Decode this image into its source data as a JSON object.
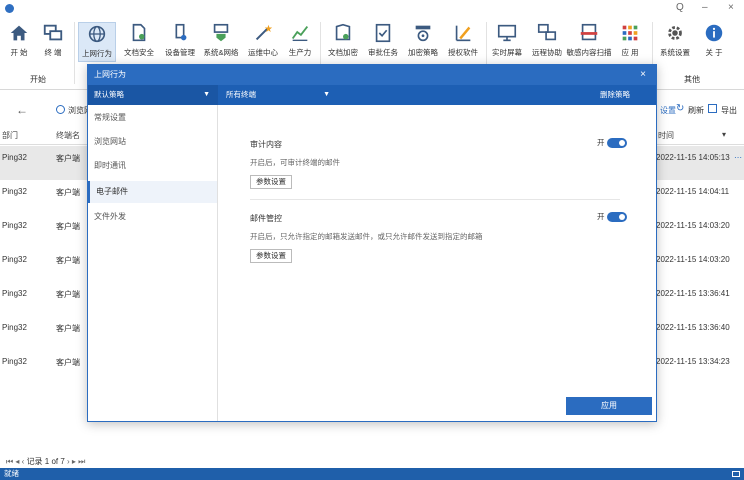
{
  "window": {
    "minimize_glyph": "–",
    "close_glyph": "×",
    "search_glyph": "Q"
  },
  "ribbon": {
    "buttons": [
      {
        "label": "开 始",
        "icon": "home-icon"
      },
      {
        "label": "终 端",
        "icon": "terminal-icon"
      },
      {
        "label": "上网行为",
        "icon": "globe-icon"
      },
      {
        "label": "文档安全",
        "icon": "document-shield-icon"
      },
      {
        "label": "设备管理",
        "icon": "device-icon"
      },
      {
        "label": "系统&网络",
        "icon": "system-network-icon"
      },
      {
        "label": "运维中心",
        "icon": "wand-icon"
      },
      {
        "label": "生产力",
        "icon": "chart-icon"
      },
      {
        "label": "文档加密",
        "icon": "encrypt-doc-icon"
      },
      {
        "label": "审批任务",
        "icon": "checklist-icon"
      },
      {
        "label": "加密策略",
        "icon": "lock-policy-icon"
      },
      {
        "label": "授权软件",
        "icon": "software-icon"
      },
      {
        "label": "实时屏幕",
        "icon": "monitor-icon"
      },
      {
        "label": "远程协助",
        "icon": "remote-icon"
      },
      {
        "label": "敏感内容扫描",
        "icon": "scan-icon"
      },
      {
        "label": "应 用",
        "icon": "apps-grid-icon"
      },
      {
        "label": "系统设置",
        "icon": "gear-icon"
      },
      {
        "label": "关 于",
        "icon": "info-icon"
      }
    ],
    "groups": {
      "start": "开始",
      "other": "其他"
    }
  },
  "subtoolbar": {
    "back_glyph": "←",
    "browse_label": "浏览网",
    "settings_label": "设置",
    "refresh_label": "刷新",
    "export_label": "导出"
  },
  "table": {
    "col_dept": "部门",
    "col_terminal": "终端名",
    "col_time": "时间",
    "rows": [
      {
        "dept": "Ping32",
        "terminal": "客户端",
        "time": "2022-11-15 14:05:13"
      },
      {
        "dept": "Ping32",
        "terminal": "客户端",
        "time": "2022-11-15 14:04:11"
      },
      {
        "dept": "Ping32",
        "terminal": "客户端",
        "time": "2022-11-15 14:03:20"
      },
      {
        "dept": "Ping32",
        "terminal": "客户端",
        "time": "2022-11-15 14:03:20"
      },
      {
        "dept": "Ping32",
        "terminal": "客户端",
        "time": "2022-11-15 13:36:41"
      },
      {
        "dept": "Ping32",
        "terminal": "客户端",
        "time": "2022-11-15 13:36:40"
      },
      {
        "dept": "Ping32",
        "terminal": "客户端",
        "time": "2022-11-15 13:34:23"
      }
    ]
  },
  "pager": {
    "text": "记录 1 of 7"
  },
  "statusbar": {
    "text": "就绪"
  },
  "modal": {
    "title": "上网行为",
    "policy": "默认策略",
    "terminal": "所有终端",
    "delete_policy": "删除策略",
    "nav": [
      "常规设置",
      "浏览网站",
      "即时通讯",
      "电子邮件",
      "文件外发"
    ],
    "settings": [
      {
        "title": "审计内容",
        "desc": "开启后，可审计终端的邮件",
        "button": "参数设置",
        "toggle_label": "开",
        "enabled": true
      },
      {
        "title": "邮件管控",
        "desc": "开启后，只允许指定的邮箱发送邮件，或只允许邮件发送到指定的邮箱",
        "button": "参数设置",
        "toggle_label": "开",
        "enabled": true
      }
    ],
    "apply": "应用"
  },
  "colors": {
    "accent": "#2b6cc0",
    "statusbar": "#1f5faa"
  }
}
